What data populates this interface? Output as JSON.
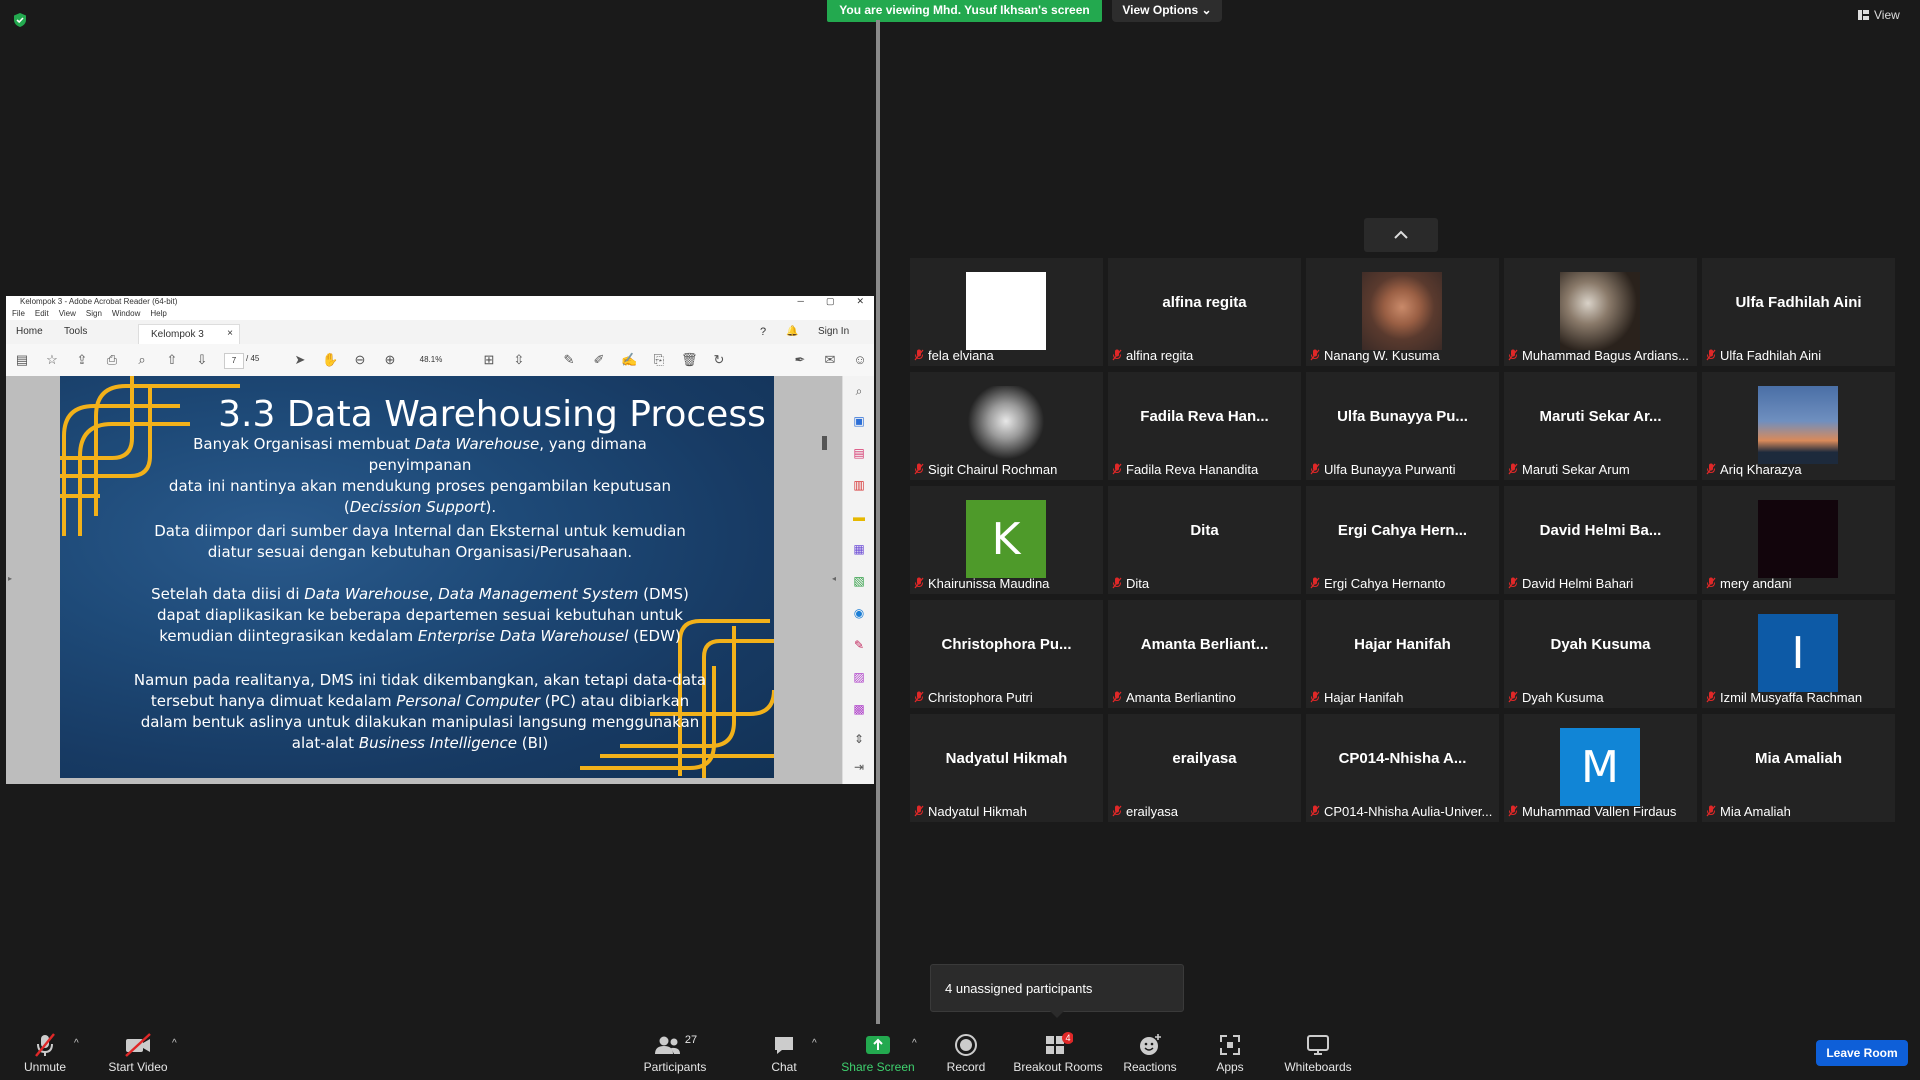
{
  "banner": {
    "viewing": "You are viewing Mhd. Yusuf Ikhsan's screen",
    "view_options": "View Options",
    "view": "View"
  },
  "acrobat": {
    "window_title": "Kelompok 3 - Adobe Acrobat Reader (64-bit)",
    "menu": [
      "File",
      "Edit",
      "View",
      "Sign",
      "Window",
      "Help"
    ],
    "tabs": {
      "home": "Home",
      "tools": "Tools",
      "doc": "Kelompok 3",
      "sign_in": "Sign In"
    },
    "page_current": "7",
    "page_total": "/ 45",
    "zoom": "48.1%"
  },
  "slide": {
    "title": "3.3 Data Warehousing Process",
    "p1": [
      "Banyak Organisasi membuat ",
      "Data Warehouse",
      ",  yang dimana penyimpanan",
      "data ini nantinya akan mendukung proses pengambilan keputusan",
      "(",
      "Decission Support",
      ")."
    ],
    "p2": [
      "Data diimpor dari sumber daya Internal dan Eksternal untuk kemudian",
      "diatur sesuai dengan kebutuhan Organisasi/Perusahaan."
    ],
    "p3": [
      "Setelah data diisi di ",
      "Data Warehouse",
      ", ",
      "Data Management System",
      " (DMS)",
      "dapat diaplikasikan ke beberapa departemen sesuai kebutuhan untuk",
      "kemudian diintegrasikan kedalam ",
      "Enterprise Data Warehousel",
      " (EDW)"
    ],
    "p4": [
      "Namun pada realitanya, DMS ini tidak dikembangkan, akan tetapi data-data",
      "tersebut hanya dimuat kedalam ",
      "Personal Computer",
      " (PC) atau dibiarkan",
      "dalam bentuk aslinya untuk dilakukan manipulasi langsung menggunakan",
      "alat-alat ",
      "Business Intelligence",
      " (BI)"
    ]
  },
  "participants": [
    {
      "center": "",
      "name": "fela elviana",
      "avatar": "white"
    },
    {
      "center": "alfina regita",
      "name": "alfina regita",
      "avatar": ""
    },
    {
      "center": "",
      "name": "Nanang W. Kusuma",
      "avatar": "photo-man"
    },
    {
      "center": "",
      "name": "Muhammad Bagus Ardians...",
      "avatar": "photo-group"
    },
    {
      "center": "Ulfa Fadhilah Aini",
      "name": "Ulfa Fadhilah Aini",
      "avatar": ""
    },
    {
      "center": "",
      "name": "Sigit Chairul Rochman",
      "avatar": "sketch"
    },
    {
      "center": "Fadila Reva Han...",
      "name": "Fadila Reva Hanandita",
      "avatar": ""
    },
    {
      "center": "Ulfa Bunayya Pu...",
      "name": "Ulfa Bunayya Purwanti",
      "avatar": ""
    },
    {
      "center": "Maruti Sekar Ar...",
      "name": "Maruti Sekar Arum",
      "avatar": ""
    },
    {
      "center": "",
      "name": "Ariq Kharazya",
      "avatar": "sky"
    },
    {
      "center": "",
      "name": "Khairunissa Maudina",
      "avatar": "letter",
      "letter": "K",
      "color": "#4e9a2a"
    },
    {
      "center": "Dita",
      "name": "Dita",
      "avatar": ""
    },
    {
      "center": "Ergi Cahya Hern...",
      "name": "Ergi Cahya Hernanto",
      "avatar": ""
    },
    {
      "center": "David Helmi Ba...",
      "name": "David Helmi Bahari",
      "avatar": ""
    },
    {
      "center": "",
      "name": "mery andani",
      "avatar": "dark"
    },
    {
      "center": "Christophora Pu...",
      "name": "Christophora Putri",
      "avatar": ""
    },
    {
      "center": "Amanta Berliant...",
      "name": "Amanta Berliantino",
      "avatar": ""
    },
    {
      "center": "Hajar Hanifah",
      "name": "Hajar Hanifah",
      "avatar": ""
    },
    {
      "center": "Dyah Kusuma",
      "name": "Dyah Kusuma",
      "avatar": ""
    },
    {
      "center": "",
      "name": "Izmil Musyaffa Rachman",
      "avatar": "letter",
      "letter": "I",
      "color": "#0d5aa6"
    },
    {
      "center": "Nadyatul Hikmah",
      "name": "Nadyatul Hikmah",
      "avatar": ""
    },
    {
      "center": "erailyasa",
      "name": "erailyasa",
      "avatar": ""
    },
    {
      "center": "CP014-Nhisha A...",
      "name": "CP014-Nhisha Aulia-Univer...",
      "avatar": ""
    },
    {
      "center": "",
      "name": "Muhammad Vallen Firdaus",
      "avatar": "letter",
      "letter": "M",
      "color": "#1185d6"
    },
    {
      "center": "Mia Amaliah",
      "name": "Mia Amaliah",
      "avatar": ""
    }
  ],
  "unassigned": "4 unassigned participants",
  "toolbar": {
    "unmute": "Unmute",
    "start_video": "Start Video",
    "participants": "Participants",
    "participants_count": "27",
    "chat": "Chat",
    "share_screen": "Share Screen",
    "record": "Record",
    "breakout_rooms": "Breakout Rooms",
    "breakout_badge": "4",
    "reactions": "Reactions",
    "apps": "Apps",
    "whiteboards": "Whiteboards",
    "leave": "Leave Room"
  },
  "colors": {
    "share_green": "#23a94f",
    "leave_blue": "#0e5fd8",
    "slide_gold": "#f2b11a"
  }
}
